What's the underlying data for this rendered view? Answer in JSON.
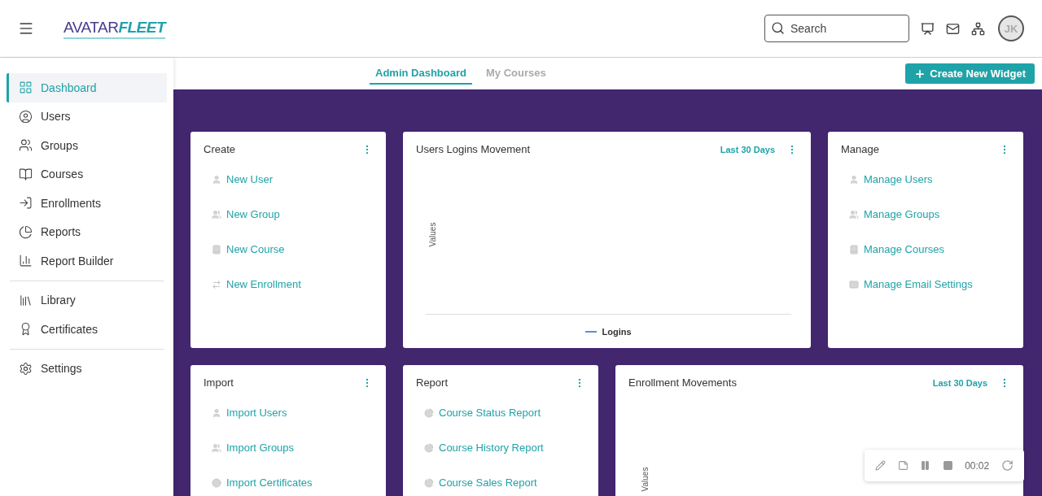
{
  "header": {
    "logo": {
      "part1": "AVATAR",
      "part2": "FLEET"
    },
    "search": {
      "placeholder": "Search"
    },
    "avatar": "JK"
  },
  "sidebar": {
    "groups": [
      [
        {
          "label": "Dashboard",
          "selected": true
        },
        {
          "label": "Users",
          "selected": false
        },
        {
          "label": "Groups",
          "selected": false
        },
        {
          "label": "Courses",
          "selected": false
        },
        {
          "label": "Enrollments",
          "selected": false
        },
        {
          "label": "Reports",
          "selected": false
        },
        {
          "label": "Report Builder",
          "selected": false
        }
      ],
      [
        {
          "label": "Library",
          "selected": false
        },
        {
          "label": "Certificates",
          "selected": false
        }
      ],
      [
        {
          "label": "Settings",
          "selected": false
        }
      ]
    ]
  },
  "tabs": [
    {
      "label": "Admin Dashboard",
      "selected": true
    },
    {
      "label": "My Courses",
      "selected": false
    }
  ],
  "create_button": "Create New Widget",
  "widgets": [
    {
      "kind": "links",
      "title": "Create",
      "links": [
        "New User",
        "New Group",
        "New Course",
        "New Enrollment"
      ]
    },
    {
      "kind": "chart",
      "title": "Users Logins Movement",
      "range": "Last 30 Days",
      "y_label": "Values",
      "legend": "Logins"
    },
    {
      "kind": "links",
      "title": "Manage",
      "links": [
        "Manage Users",
        "Manage Groups",
        "Manage Courses",
        "Manage Email Settings"
      ]
    },
    {
      "kind": "links",
      "title": "Import",
      "links": [
        "Import Users",
        "Import Groups",
        "Import Certificates"
      ]
    },
    {
      "kind": "links",
      "title": "Report",
      "links": [
        "Course Status Report",
        "Course History Report",
        "Course Sales Report"
      ]
    },
    {
      "kind": "chart",
      "title": "Enrollment Movements",
      "range": "Last 30 Days",
      "y_label": "Values"
    }
  ],
  "recorder": {
    "time": "00:02"
  }
}
